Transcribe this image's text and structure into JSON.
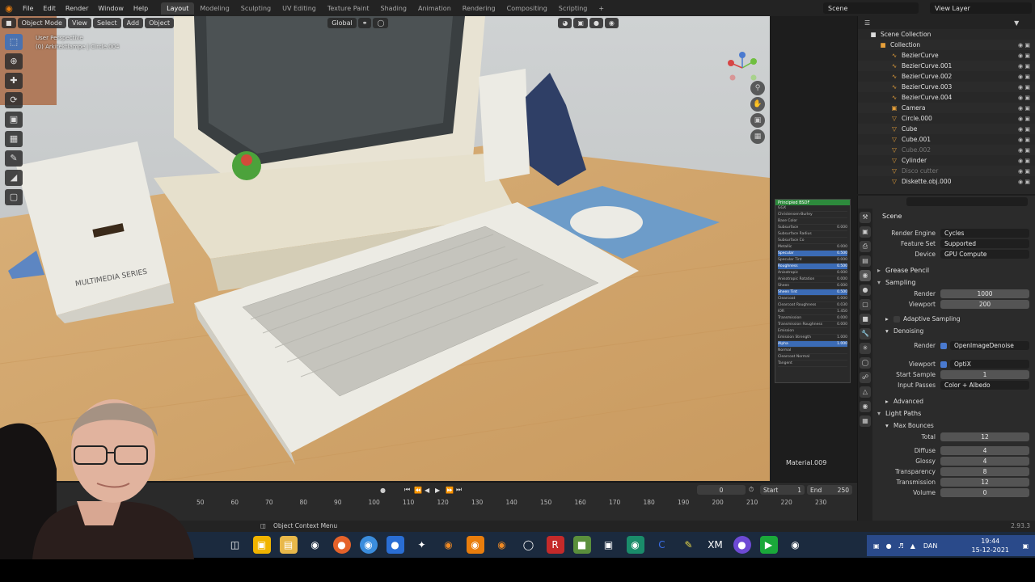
{
  "topbar": {
    "menu": [
      "File",
      "Edit",
      "Render",
      "Window",
      "Help"
    ],
    "workspaces": [
      "Layout",
      "Modeling",
      "Sculpting",
      "UV Editing",
      "Texture Paint",
      "Shading",
      "Animation",
      "Rendering",
      "Compositing",
      "Scripting"
    ],
    "active_workspace": "Layout",
    "scene": "Scene",
    "view_layer": "View Layer"
  },
  "viewport": {
    "mode": "Object Mode",
    "menus": [
      "View",
      "Select",
      "Add",
      "Object"
    ],
    "transform_orientation": "Global",
    "perspective_label": "User Perspective",
    "object_label": "(0) Arkitektlampe | Circle.004",
    "scene_text": {
      "speaker_label": "MULTIMEDIA SERIES"
    },
    "material_label": "Material.009",
    "object_type": "Object"
  },
  "node_panel": {
    "title": "Principled BSDF",
    "rows": [
      {
        "label": "GGX",
        "value": "",
        "hl": false
      },
      {
        "label": "Christensen-Burley",
        "value": "",
        "hl": false
      },
      {
        "label": "Base Color",
        "value": "",
        "hl": false
      },
      {
        "label": "Subsurface",
        "value": "0.000",
        "hl": false
      },
      {
        "label": "Subsurface Radius",
        "value": "",
        "hl": false
      },
      {
        "label": "Subsurface Co",
        "value": "",
        "hl": false
      },
      {
        "label": "Metallic",
        "value": "0.000",
        "hl": false
      },
      {
        "label": "Specular",
        "value": "0.500",
        "hl": true
      },
      {
        "label": "Specular Tint",
        "value": "0.000",
        "hl": false
      },
      {
        "label": "Roughness",
        "value": "0.500",
        "hl": true
      },
      {
        "label": "Anisotropic",
        "value": "0.000",
        "hl": false
      },
      {
        "label": "Anisotropic Rotation",
        "value": "0.000",
        "hl": false
      },
      {
        "label": "Sheen",
        "value": "0.000",
        "hl": false
      },
      {
        "label": "Sheen Tint",
        "value": "0.500",
        "hl": true
      },
      {
        "label": "Clearcoat",
        "value": "0.000",
        "hl": false
      },
      {
        "label": "Clearcoat Roughness",
        "value": "0.030",
        "hl": false
      },
      {
        "label": "IOR",
        "value": "1.450",
        "hl": false
      },
      {
        "label": "Transmission",
        "value": "0.000",
        "hl": false
      },
      {
        "label": "Transmission Roughness",
        "value": "0.000",
        "hl": false
      },
      {
        "label": "Emission",
        "value": "",
        "hl": false
      },
      {
        "label": "Emission Strength",
        "value": "1.000",
        "hl": false
      },
      {
        "label": "Alpha",
        "value": "1.000",
        "hl": true
      },
      {
        "label": "Normal",
        "value": "",
        "hl": false
      },
      {
        "label": "Clearcoat Normal",
        "value": "",
        "hl": false
      },
      {
        "label": "Tangent",
        "value": "",
        "hl": false
      }
    ]
  },
  "outliner": {
    "root": "Scene Collection",
    "items": [
      {
        "name": "Collection",
        "icon": "collection-icon",
        "dim": false
      },
      {
        "name": "BezierCurve",
        "icon": "curve-icon",
        "dim": false
      },
      {
        "name": "BezierCurve.001",
        "icon": "curve-icon",
        "dim": false
      },
      {
        "name": "BezierCurve.002",
        "icon": "curve-icon",
        "dim": false
      },
      {
        "name": "BezierCurve.003",
        "icon": "curve-icon",
        "dim": false
      },
      {
        "name": "BezierCurve.004",
        "icon": "curve-icon",
        "dim": false
      },
      {
        "name": "Camera",
        "icon": "camera-icon",
        "dim": false
      },
      {
        "name": "Circle.000",
        "icon": "mesh-icon",
        "dim": false
      },
      {
        "name": "Cube",
        "icon": "mesh-icon",
        "dim": false
      },
      {
        "name": "Cube.001",
        "icon": "mesh-icon",
        "dim": false
      },
      {
        "name": "Cube.002",
        "icon": "mesh-icon",
        "dim": true
      },
      {
        "name": "Cylinder",
        "icon": "mesh-icon",
        "dim": false
      },
      {
        "name": "Disco cutter",
        "icon": "mesh-icon",
        "dim": true
      },
      {
        "name": "Diskette.obj.000",
        "icon": "mesh-icon",
        "dim": false
      }
    ]
  },
  "properties": {
    "title": "Scene",
    "render_engine_label": "Render Engine",
    "render_engine": "Cycles",
    "feature_set_label": "Feature Set",
    "feature_set": "Supported",
    "device_label": "Device",
    "device": "GPU Compute",
    "grease_pencil": "Grease Pencil",
    "sampling": "Sampling",
    "render_label": "Render",
    "render_samples": "1000",
    "viewport_label": "Viewport",
    "viewport_samples": "200",
    "adaptive_sampling": "Adaptive Sampling",
    "denoising": "Denoising",
    "denoise_render_label": "Render",
    "denoise_render": "OpenImageDenoise",
    "denoise_viewport_label": "Viewport",
    "denoise_viewport": "OptiX",
    "start_sample_label": "Start Sample",
    "start_sample": "1",
    "input_passes_label": "Input Passes",
    "input_passes": "Color + Albedo",
    "advanced": "Advanced",
    "light_paths": "Light Paths",
    "max_bounces": "Max Bounces",
    "bounces": [
      {
        "label": "Total",
        "value": "12"
      },
      {
        "label": "Diffuse",
        "value": "4"
      },
      {
        "label": "Glossy",
        "value": "4"
      },
      {
        "label": "Transparency",
        "value": "8"
      },
      {
        "label": "Transmission",
        "value": "12"
      },
      {
        "label": "Volume",
        "value": "0"
      }
    ]
  },
  "timeline": {
    "ruler": [
      "50",
      "60",
      "70",
      "80",
      "90",
      "100",
      "110",
      "120",
      "130",
      "140",
      "150",
      "160",
      "170",
      "180",
      "190",
      "200",
      "210",
      "220",
      "230"
    ],
    "current_frame": "0",
    "start_label": "Start",
    "start": "1",
    "end_label": "End",
    "end": "250",
    "playback": "Pl"
  },
  "status": {
    "hint": "Object Context Menu",
    "version": "2.93.3"
  },
  "taskbar": {
    "time": "19:44",
    "date": "15-12-2021",
    "lang": "DAN"
  },
  "colors": {
    "accent": "#4a72b0",
    "blender_orange": "#e87d0d",
    "node_header": "#2d8a3c",
    "taskbar": "#1b2a3e"
  }
}
